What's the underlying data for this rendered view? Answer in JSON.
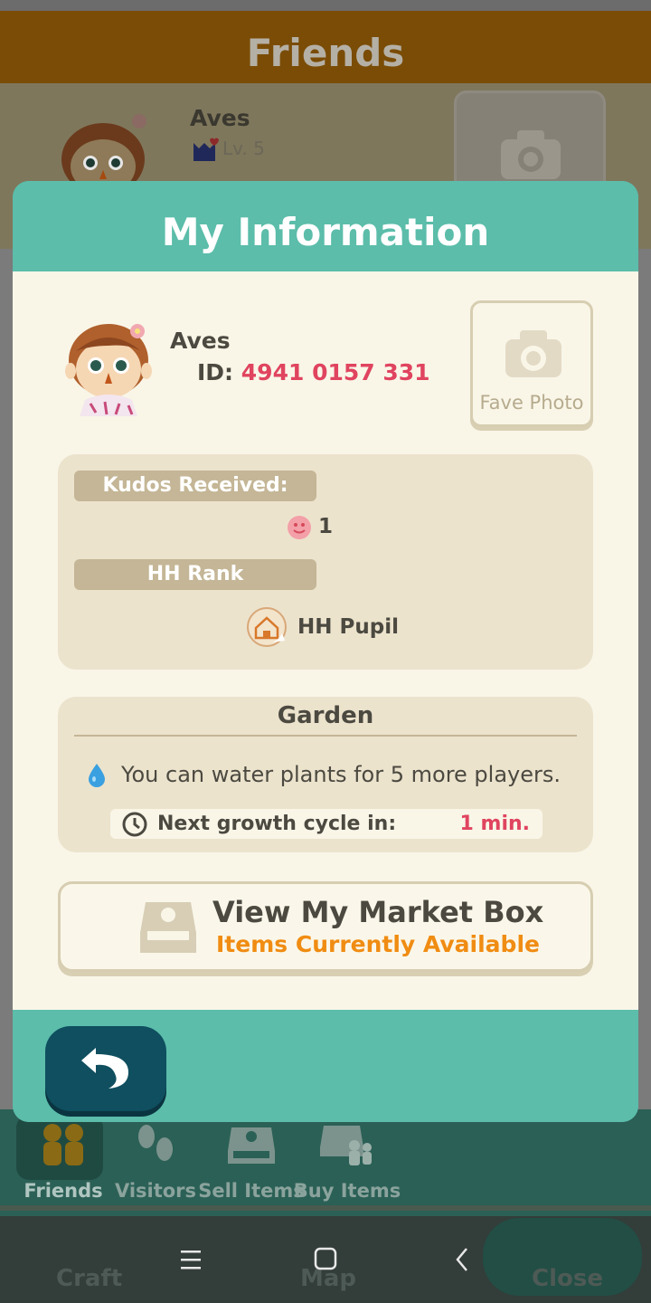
{
  "background": {
    "title": "Friends",
    "friend": {
      "name": "Aves",
      "level": "Lv. 5"
    },
    "nav_tabs": [
      {
        "label": "Friends",
        "icon": "friends-icon",
        "active": true
      },
      {
        "label": "Visitors",
        "icon": "footprints-icon",
        "active": false
      },
      {
        "label": "Sell Items",
        "icon": "market-box-icon",
        "active": false
      },
      {
        "label": "Buy Items",
        "icon": "shop-people-icon",
        "active": false
      }
    ],
    "bottom_bar": {
      "craft": "Craft",
      "map": "Map",
      "close": "Close"
    }
  },
  "modal": {
    "title": "My Information",
    "player": {
      "name": "Aves",
      "id_label": "ID:",
      "id_value": "4941 0157 331"
    },
    "fave_photo_label": "Fave Photo",
    "kudos": {
      "label": "Kudos Received:",
      "count": "1"
    },
    "rank": {
      "label": "HH Rank",
      "value": "HH Pupil"
    },
    "garden": {
      "title": "Garden",
      "water_text": "You can water plants for 5 more players.",
      "growth_label": "Next growth cycle in:",
      "growth_value": "1 min."
    },
    "market": {
      "title": "View My Market Box",
      "subtitle": "Items Currently Available"
    }
  },
  "colors": {
    "accent_teal": "#5bbdaa",
    "id_pink": "#e0445f",
    "orange": "#f08c12",
    "back_button": "#0f4f5f"
  }
}
